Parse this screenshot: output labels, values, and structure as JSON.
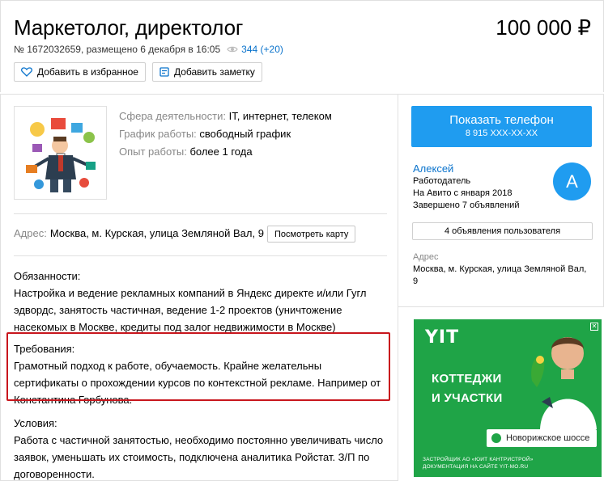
{
  "listing": {
    "title": "Маркетолог, директолог",
    "price": "100 000 ₽",
    "meta_text": "№ 1672032659, размещено 6 декабря в 16:05",
    "views": "344 (+20)",
    "favorite_label": "Добавить в избранное",
    "note_label": "Добавить заметку"
  },
  "properties": [
    {
      "label": "Сфера деятельности:",
      "value": "IT, интернет, телеком"
    },
    {
      "label": "График работы:",
      "value": "свободный график"
    },
    {
      "label": "Опыт работы:",
      "value": "более 1 года"
    }
  ],
  "address": {
    "label": "Адрес:",
    "value": "Москва, м. Курская, улица Земляной Вал, 9",
    "map_button": "Посмотреть карту"
  },
  "description": {
    "duties_title": "Обязанности:",
    "duties_text": "Настройка и ведение рекламных компаний в Яндекс директе и/или Гугл эдвордс, занятость частичная, ведение 1-2 проектов (уничтожение насекомых в Москве, кредиты под залог недвижимости в Москве)",
    "req_title": "Требования:",
    "req_text": "Грамотный подход к работе, обучаемость. Крайне желательны сертификаты о прохождении курсов по контекстной рекламе. Например от Константина Горбунова.",
    "cond_title": "Условия:",
    "cond_text": "Работа с частичной занятостью, необходимо постоянно увеличивать число заявок, уменьшать их стоимость, подключена аналитика Ройстат. З/П по договоренности."
  },
  "seller": {
    "phone_button": "Показать телефон",
    "phone_number": "8 915 XXX-XX-XX",
    "name": "Алексей",
    "role": "Работодатель",
    "since": "На Авито с января 2018",
    "completed": "Завершено 7 объявлений",
    "avatar_letter": "A",
    "ads_button": "4 объявления пользователя",
    "address_label": "Адрес",
    "address_value": "Москва, м. Курская, улица Земляной Вал, 9"
  },
  "banner": {
    "logo": "YIT",
    "headline_1": "КОТТЕДЖИ",
    "headline_2": "И УЧАСТКИ",
    "location": "Новорижское шоссе",
    "footer_1": "ЗАСТРОЙЩИК АО «ЮИТ КАНТРИСТРОЙ»",
    "footer_2": "ДОКУМЕНТАЦИЯ НА САЙТЕ YIT-MO.RU"
  },
  "colors": {
    "accent_blue": "#1f9cf0",
    "link_blue": "#0a73cc",
    "highlight_red": "#c8161d",
    "banner_green": "#1fa447"
  }
}
